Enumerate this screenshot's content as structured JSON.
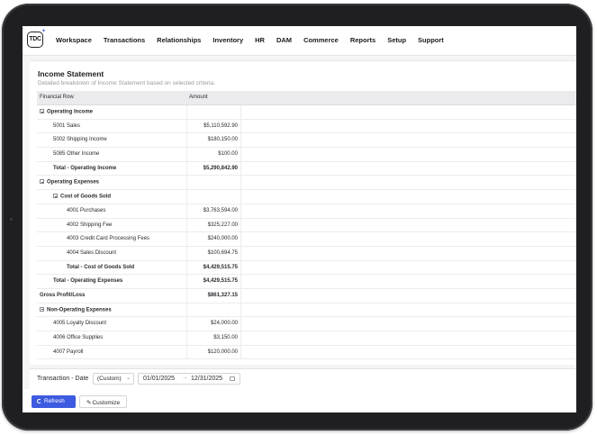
{
  "app": {
    "logo_text": "TDC"
  },
  "nav": [
    "Workspace",
    "Transactions",
    "Relationships",
    "Inventory",
    "HR",
    "DAM",
    "Commerce",
    "Reports",
    "Setup",
    "Support"
  ],
  "panel": {
    "title": "Income Statement",
    "subtitle": "Detailed breakdown of Income Statement based on selected criteria."
  },
  "grid": {
    "columns": [
      "Financial Row",
      "Amount"
    ],
    "rows": [
      {
        "label": "Operating Income",
        "amount": "",
        "level": 0,
        "bold": true,
        "toggle": true
      },
      {
        "label": "5001 Sales",
        "amount": "$5,110,592.90",
        "level": 1,
        "bold": false,
        "toggle": false
      },
      {
        "label": "5002 Shipping Income",
        "amount": "$180,150.00",
        "level": 1,
        "bold": false,
        "toggle": false
      },
      {
        "label": "5085 Other Income",
        "amount": "$100.00",
        "level": 1,
        "bold": false,
        "toggle": false
      },
      {
        "label": "Total - Operating Income",
        "amount": "$5,290,842.90",
        "level": 1,
        "bold": true,
        "toggle": false
      },
      {
        "label": "Operating Expenses",
        "amount": "",
        "level": 0,
        "bold": true,
        "toggle": true
      },
      {
        "label": "Cost of Goods Sold",
        "amount": "",
        "level": 1,
        "bold": true,
        "toggle": true
      },
      {
        "label": "4001 Purchases",
        "amount": "$3,763,594.00",
        "level": 2,
        "bold": false,
        "toggle": false
      },
      {
        "label": "4002 Shipping Fee",
        "amount": "$325,227.00",
        "level": 2,
        "bold": false,
        "toggle": false
      },
      {
        "label": "4003 Credit Card Processing Fees",
        "amount": "$240,000.00",
        "level": 2,
        "bold": false,
        "toggle": false
      },
      {
        "label": "4004 Sales Discount",
        "amount": "$100,694.75",
        "level": 2,
        "bold": false,
        "toggle": false
      },
      {
        "label": "Total - Cost of Goods Sold",
        "amount": "$4,429,515.75",
        "level": 2,
        "bold": true,
        "toggle": false
      },
      {
        "label": "Total - Operating Expenses",
        "amount": "$4,429,515.75",
        "level": 1,
        "bold": true,
        "toggle": false
      },
      {
        "label": "Gross Profit/Loss",
        "amount": "$861,327.15",
        "level": 0,
        "bold": true,
        "toggle": false,
        "no_toggle_indent": true
      },
      {
        "label": "Non-Operating Expenses",
        "amount": "",
        "level": 0,
        "bold": true,
        "toggle": true
      },
      {
        "label": "4005 Loyalty Discount",
        "amount": "$24,000.00",
        "level": 1,
        "bold": false,
        "toggle": false
      },
      {
        "label": "4006 Office Supplies",
        "amount": "$3,150.00",
        "level": 1,
        "bold": false,
        "toggle": false
      },
      {
        "label": "4007 Payroll",
        "amount": "$120,000.00",
        "level": 1,
        "bold": false,
        "toggle": false
      }
    ]
  },
  "filter": {
    "label": "Transaction - Date",
    "range_option": "(Custom)",
    "date_from": "01/01/2025",
    "date_arrow": "→",
    "date_to": "12/31/2025"
  },
  "actions": {
    "refresh_label": "Refresh",
    "customize_label": "Customize"
  }
}
